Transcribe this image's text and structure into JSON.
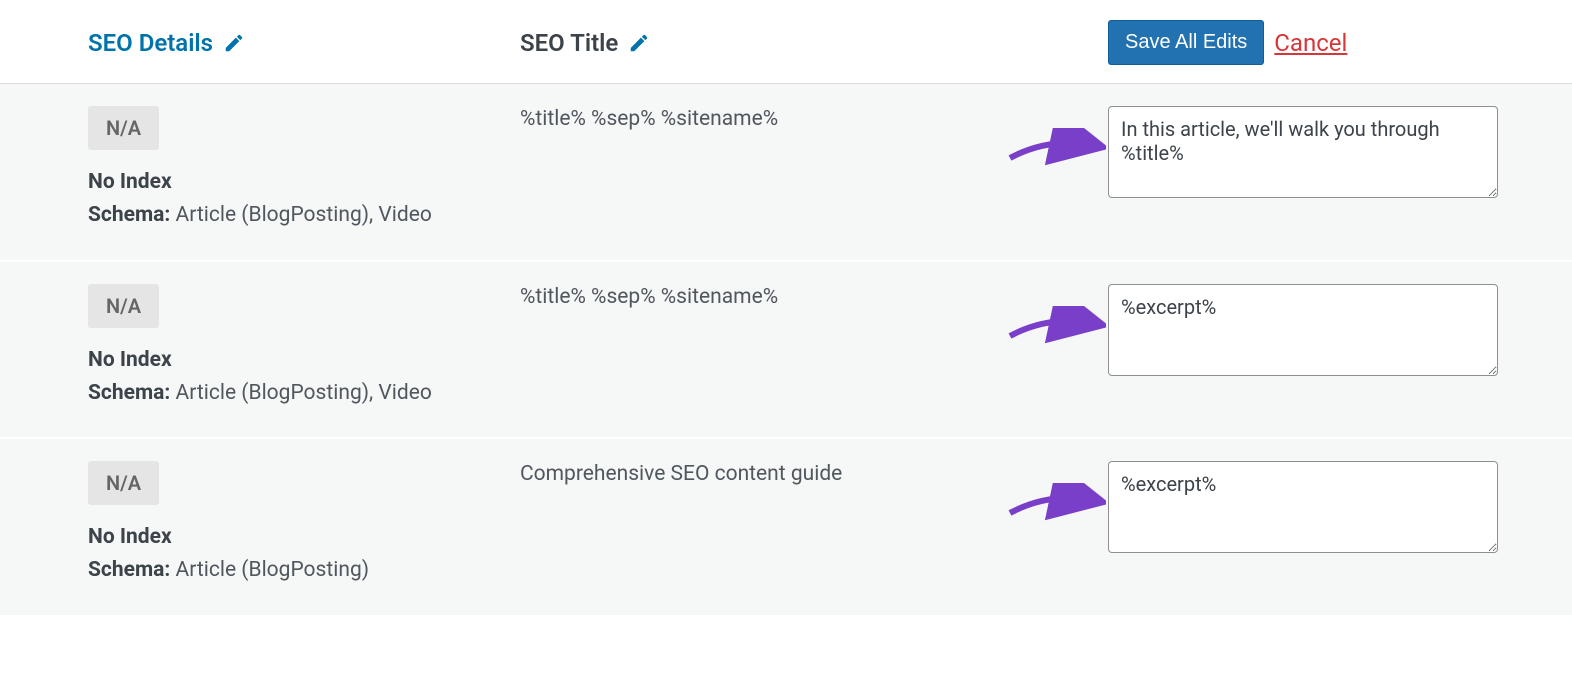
{
  "header": {
    "seo_details": "SEO Details",
    "seo_title": "SEO Title",
    "save_label": "Save All Edits",
    "cancel_label": "Cancel"
  },
  "rows": [
    {
      "badge": "N/A",
      "noindex": "No Index",
      "schema_label": "Schema:",
      "schema_value": "Article (BlogPosting), Video",
      "seo_title": "%title% %sep% %sitename%",
      "description": "In this article, we'll walk you through %title%"
    },
    {
      "badge": "N/A",
      "noindex": "No Index",
      "schema_label": "Schema:",
      "schema_value": "Article (BlogPosting), Video",
      "seo_title": "%title% %sep% %sitename%",
      "description": "%excerpt%"
    },
    {
      "badge": "N/A",
      "noindex": "No Index",
      "schema_label": "Schema:",
      "schema_value": "Article (BlogPosting)",
      "seo_title": "Comprehensive SEO content guide",
      "description": "%excerpt%"
    }
  ]
}
